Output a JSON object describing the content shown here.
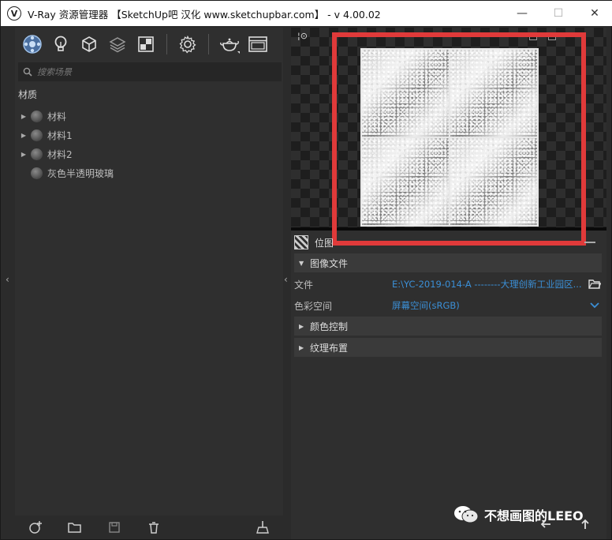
{
  "window": {
    "title": "V-Ray 资源管理器 【SketchUp吧 汉化 www.sketchupbar.com】 - v 4.00.02",
    "logo": "V",
    "minimize": "—",
    "maximize": "☐",
    "close": "✕"
  },
  "toolbar": {
    "icons": [
      "materials-icon",
      "lights-icon",
      "geometry-icon",
      "layers-icon",
      "textures-icon",
      "settings-icon",
      "teapot-render-icon",
      "frame-buffer-icon"
    ]
  },
  "search": {
    "placeholder": "搜索场景"
  },
  "materials": {
    "section_title": "材质",
    "items": [
      {
        "label": "材料",
        "expandable": true
      },
      {
        "label": "材料1",
        "expandable": true
      },
      {
        "label": "材料2",
        "expandable": true
      },
      {
        "label": "灰色半透明玻璃",
        "expandable": false
      }
    ]
  },
  "bitmap": {
    "header": "位图",
    "image_file_group": "图像文件",
    "file_label": "文件",
    "file_value": "E:\\YC-2019-014-A --------大理创新工业园区...",
    "colorspace_label": "色彩空间",
    "colorspace_value": "屏幕空间(sRGB)",
    "color_control_group": "颜色控制",
    "texture_placement_group": "纹理布置"
  },
  "watermark": {
    "text": "不想画图的LEEO"
  },
  "colors": {
    "highlight": "#e03a3a",
    "link_blue": "#3b8fd6"
  }
}
